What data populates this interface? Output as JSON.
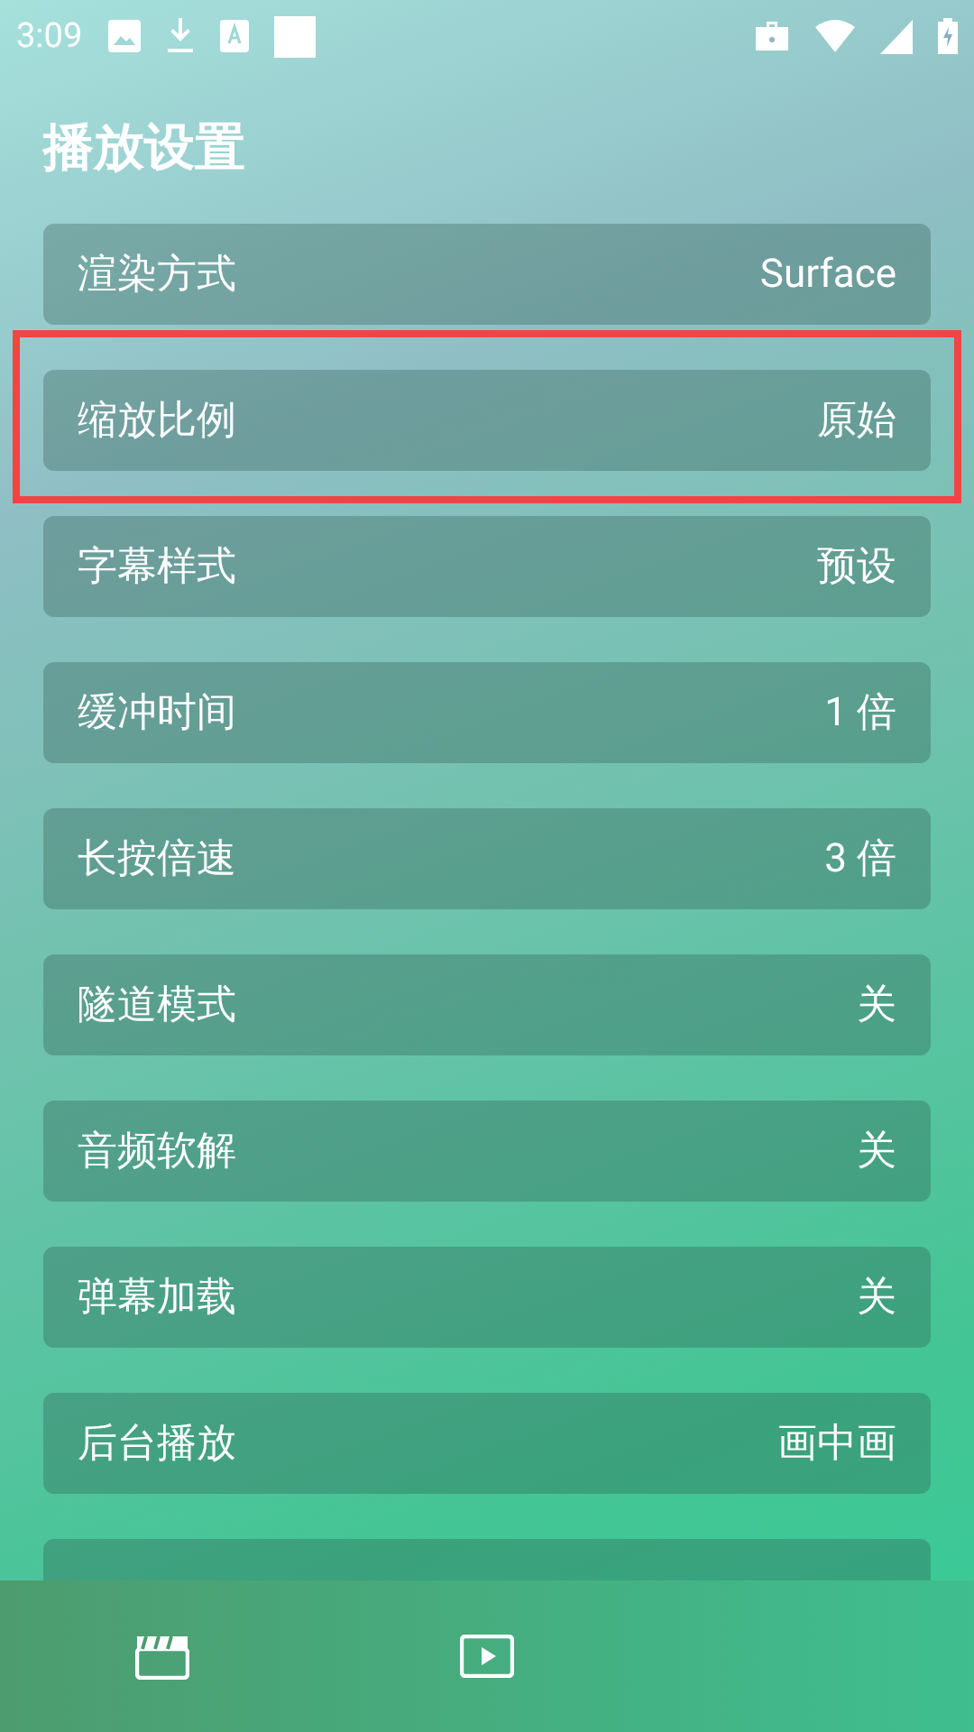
{
  "status_bar": {
    "time": "3:09"
  },
  "title": "播放设置",
  "settings": [
    {
      "label": "渲染方式",
      "value": "Surface",
      "highlighted": false
    },
    {
      "label": "缩放比例",
      "value": "原始",
      "highlighted": true
    },
    {
      "label": "字幕样式",
      "value": "预设",
      "highlighted": false
    },
    {
      "label": "缓冲时间",
      "value": "1 倍",
      "highlighted": false
    },
    {
      "label": "长按倍速",
      "value": "3 倍",
      "highlighted": false
    },
    {
      "label": "隧道模式",
      "value": "关",
      "highlighted": false
    },
    {
      "label": "音频软解",
      "value": "关",
      "highlighted": false
    },
    {
      "label": "弹幕加载",
      "value": "关",
      "highlighted": false
    },
    {
      "label": "后台播放",
      "value": "画中画",
      "highlighted": false
    },
    {
      "highlighted": false
    }
  ]
}
